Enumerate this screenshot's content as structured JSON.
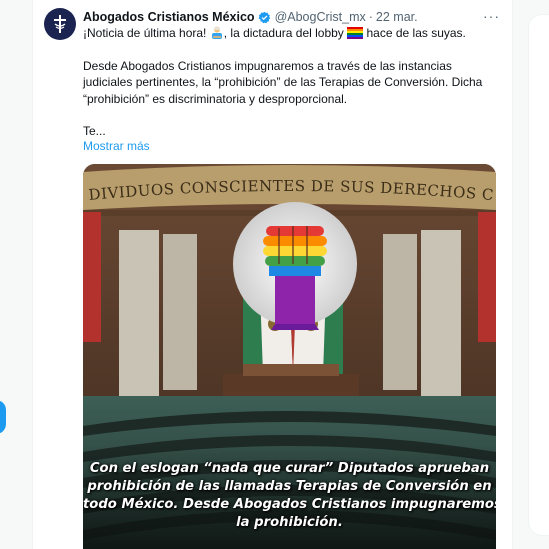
{
  "tweet": {
    "display_name": "Abogados Cristianos México",
    "handle": "@AbogCrist_mx",
    "separator": "·",
    "date": "22 mar.",
    "more_glyph": "···",
    "line1_a": "¡Noticia de última hora! ",
    "line1_b": ", la dictadura del lobby ",
    "line1_c": " hace de las suyas.",
    "paragraph2": "Desde Abogados Cristianos impugnaremos a través de las instancias judiciales pertinentes, la “prohibición” de las Terapias de Conversión. Dicha “prohibición” es discriminatoria y desproporcional.",
    "paragraph3": "Te...",
    "show_more": "Mostrar más"
  },
  "media": {
    "inscription": "DIVIDUOS CONSCIENTES DE SUS DERECHOS CONSTITUCIONALES EL RESPETO AL DERECHO AJENO",
    "caption_lines": [
      "Con el eslogan “nada que curar” Diputados aprueban",
      "prohibición de las llamadas Terapias de Conversión en",
      "todo México. Desde Abogados Cristianos impugnaremos",
      "la prohibición."
    ]
  },
  "colors": {
    "accent": "#1d9bf0",
    "text": "#0f1419",
    "muted": "#536471"
  },
  "icons": [
    "cross-logo-icon",
    "verified-badge-icon",
    "more-options-icon",
    "judge-emoji-icon",
    "rainbow-flag-emoji-icon"
  ]
}
